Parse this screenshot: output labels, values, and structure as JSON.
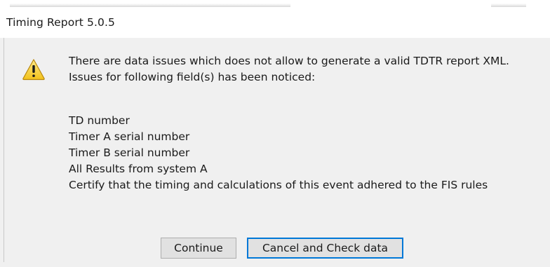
{
  "window": {
    "title": "Timing Report 5.0.5"
  },
  "dialog": {
    "icon": "warning-icon",
    "icon_color": "#f7d43b",
    "message_lines": [
      "There are data issues which does not allow to generate a valid TDTR report XML.",
      "Issues for following field(s) has been noticed:"
    ],
    "issues": [
      "TD number",
      "Timer A serial number",
      "Timer B serial number",
      "All Results from system A",
      "Certify that the timing and calculations of this event adhered to the FIS rules"
    ]
  },
  "buttons": {
    "continue_label": "Continue",
    "cancel_label": "Cancel and Check data",
    "focus_color": "#0078d7"
  }
}
